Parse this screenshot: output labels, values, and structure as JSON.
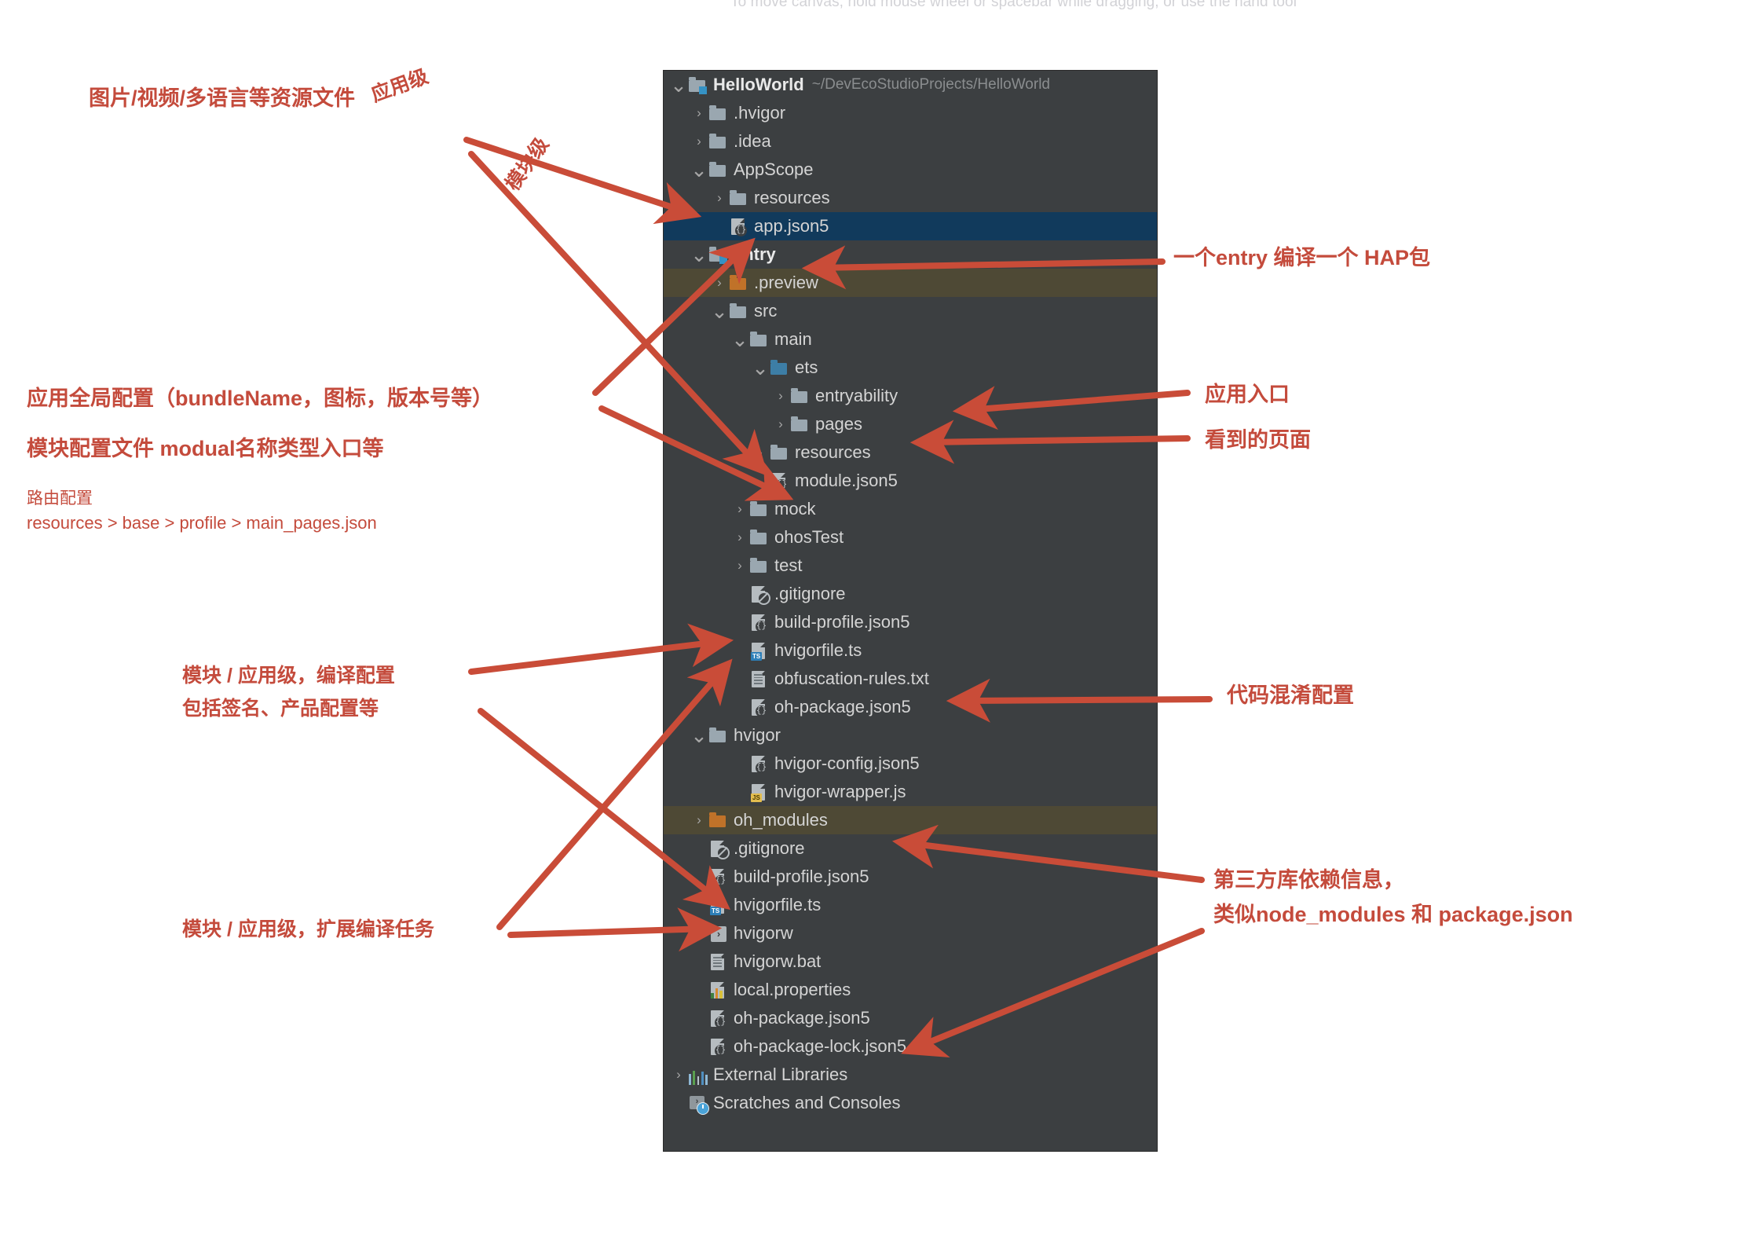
{
  "canvas": {
    "hint": "To move canvas, hold mouse wheel or spacebar while dragging, or use the hand tool",
    "accent_red": "#c44b3c",
    "panel_bg": "#3c3f41",
    "selected_blue": "#113a5c",
    "selected_olive": "#4e4935"
  },
  "project_tree": {
    "root_label": "HelloWorld",
    "root_path": "~/DevEcoStudioProjects/HelloWorld",
    "rows": [
      {
        "label": "HelloWorld",
        "path": "~/DevEcoStudioProjects/HelloWorld",
        "indent": 0,
        "arrow": "v",
        "icon": "module-folder-icon",
        "bold": true,
        "state": "none"
      },
      {
        "label": ".hvigor",
        "path": "",
        "indent": 1,
        "arrow": ">",
        "icon": "folder-icon",
        "bold": false,
        "state": "none"
      },
      {
        "label": ".idea",
        "path": "",
        "indent": 1,
        "arrow": ">",
        "icon": "folder-icon",
        "bold": false,
        "state": "none"
      },
      {
        "label": "AppScope",
        "path": "",
        "indent": 1,
        "arrow": "v",
        "icon": "folder-icon",
        "bold": false,
        "state": "none"
      },
      {
        "label": "resources",
        "path": "",
        "indent": 2,
        "arrow": ">",
        "icon": "folder-icon",
        "bold": false,
        "state": "none"
      },
      {
        "label": "app.json5",
        "path": "",
        "indent": 2,
        "arrow": "",
        "icon": "json5-file-icon",
        "bold": false,
        "state": "selected-blue"
      },
      {
        "label": "entry",
        "path": "",
        "indent": 1,
        "arrow": "v",
        "icon": "module-folder-icon",
        "bold": true,
        "state": "none"
      },
      {
        "label": ".preview",
        "path": "",
        "indent": 2,
        "arrow": ">",
        "icon": "folder-orange-icon",
        "bold": false,
        "state": "selected-olive"
      },
      {
        "label": "src",
        "path": "",
        "indent": 2,
        "arrow": "v",
        "icon": "folder-icon",
        "bold": false,
        "state": "none"
      },
      {
        "label": "main",
        "path": "",
        "indent": 3,
        "arrow": "v",
        "icon": "folder-icon",
        "bold": false,
        "state": "none"
      },
      {
        "label": "ets",
        "path": "",
        "indent": 4,
        "arrow": "v",
        "icon": "folder-blue-icon",
        "bold": false,
        "state": "none"
      },
      {
        "label": "entryability",
        "path": "",
        "indent": 5,
        "arrow": ">",
        "icon": "folder-icon",
        "bold": false,
        "state": "none"
      },
      {
        "label": "pages",
        "path": "",
        "indent": 5,
        "arrow": ">",
        "icon": "folder-icon",
        "bold": false,
        "state": "none"
      },
      {
        "label": "resources",
        "path": "",
        "indent": 4,
        "arrow": ">",
        "icon": "folder-icon",
        "bold": false,
        "state": "none"
      },
      {
        "label": "module.json5",
        "path": "",
        "indent": 4,
        "arrow": "",
        "icon": "json5-file-icon",
        "bold": false,
        "state": "none"
      },
      {
        "label": "mock",
        "path": "",
        "indent": 3,
        "arrow": ">",
        "icon": "folder-icon",
        "bold": false,
        "state": "none"
      },
      {
        "label": "ohosTest",
        "path": "",
        "indent": 3,
        "arrow": ">",
        "icon": "folder-icon",
        "bold": false,
        "state": "none"
      },
      {
        "label": "test",
        "path": "",
        "indent": 3,
        "arrow": ">",
        "icon": "folder-icon",
        "bold": false,
        "state": "none"
      },
      {
        "label": ".gitignore",
        "path": "",
        "indent": 3,
        "arrow": "",
        "icon": "gitignore-file-icon",
        "bold": false,
        "state": "none"
      },
      {
        "label": "build-profile.json5",
        "path": "",
        "indent": 3,
        "arrow": "",
        "icon": "json5-file-icon",
        "bold": false,
        "state": "none"
      },
      {
        "label": "hvigorfile.ts",
        "path": "",
        "indent": 3,
        "arrow": "",
        "icon": "ts-file-icon",
        "bold": false,
        "state": "none"
      },
      {
        "label": "obfuscation-rules.txt",
        "path": "",
        "indent": 3,
        "arrow": "",
        "icon": "txt-file-icon",
        "bold": false,
        "state": "none"
      },
      {
        "label": "oh-package.json5",
        "path": "",
        "indent": 3,
        "arrow": "",
        "icon": "json5-file-icon",
        "bold": false,
        "state": "none"
      },
      {
        "label": "hvigor",
        "path": "",
        "indent": 1,
        "arrow": "v",
        "icon": "folder-icon",
        "bold": false,
        "state": "none"
      },
      {
        "label": "hvigor-config.json5",
        "path": "",
        "indent": 3,
        "arrow": "",
        "icon": "json5-file-icon",
        "bold": false,
        "state": "none"
      },
      {
        "label": "hvigor-wrapper.js",
        "path": "",
        "indent": 3,
        "arrow": "",
        "icon": "js-file-icon",
        "bold": false,
        "state": "none"
      },
      {
        "label": "oh_modules",
        "path": "",
        "indent": 1,
        "arrow": ">",
        "icon": "folder-orange-icon",
        "bold": false,
        "state": "selected-olive"
      },
      {
        "label": ".gitignore",
        "path": "",
        "indent": 1,
        "arrow": "",
        "icon": "gitignore-file-icon",
        "bold": false,
        "state": "none"
      },
      {
        "label": "build-profile.json5",
        "path": "",
        "indent": 1,
        "arrow": "",
        "icon": "json5-file-icon",
        "bold": false,
        "state": "none"
      },
      {
        "label": "hvigorfile.ts",
        "path": "",
        "indent": 1,
        "arrow": "",
        "icon": "ts-file-icon",
        "bold": false,
        "state": "none"
      },
      {
        "label": "hvigorw",
        "path": "",
        "indent": 1,
        "arrow": "",
        "icon": "executable-file-icon",
        "bold": false,
        "state": "none"
      },
      {
        "label": "hvigorw.bat",
        "path": "",
        "indent": 1,
        "arrow": "",
        "icon": "txt-file-icon",
        "bold": false,
        "state": "none"
      },
      {
        "label": "local.properties",
        "path": "",
        "indent": 1,
        "arrow": "",
        "icon": "properties-file-icon",
        "bold": false,
        "state": "none"
      },
      {
        "label": "oh-package.json5",
        "path": "",
        "indent": 1,
        "arrow": "",
        "icon": "json5-file-icon",
        "bold": false,
        "state": "none"
      },
      {
        "label": "oh-package-lock.json5",
        "path": "",
        "indent": 1,
        "arrow": "",
        "icon": "json5-file-icon",
        "bold": false,
        "state": "none"
      },
      {
        "label": "External Libraries",
        "path": "",
        "indent": 0,
        "arrow": ">",
        "icon": "libraries-icon",
        "bold": false,
        "state": "none"
      },
      {
        "label": "Scratches and Consoles",
        "path": "",
        "indent": 0,
        "arrow": "",
        "icon": "scratches-icon",
        "bold": false,
        "state": "none"
      }
    ]
  },
  "annotations": {
    "resource_files": "图片/视频/多语言等资源文件",
    "app_level": "应用级",
    "module_level": "模块级",
    "global_config": "应用全局配置（bundleName，图标，版本号等）",
    "module_config": "模块配置文件 modual名称类型入口等",
    "route_title": "路由配置",
    "route_path": "resources > base > profile > main_pages.json",
    "compile_config_l1": "模块 / 应用级，编译配置",
    "compile_config_l2": "包括签名、产品配置等",
    "extend_task": "模块 / 应用级，扩展编译任务",
    "entry_hap": "一个entry 编译一个 HAP包",
    "app_entrance": "应用入口",
    "visible_pages": "看到的页面",
    "obfuscation": "代码混淆配置",
    "thirdparty_l1": "第三方库依赖信息，",
    "thirdparty_l2": "类似node_modules 和 package.json"
  }
}
